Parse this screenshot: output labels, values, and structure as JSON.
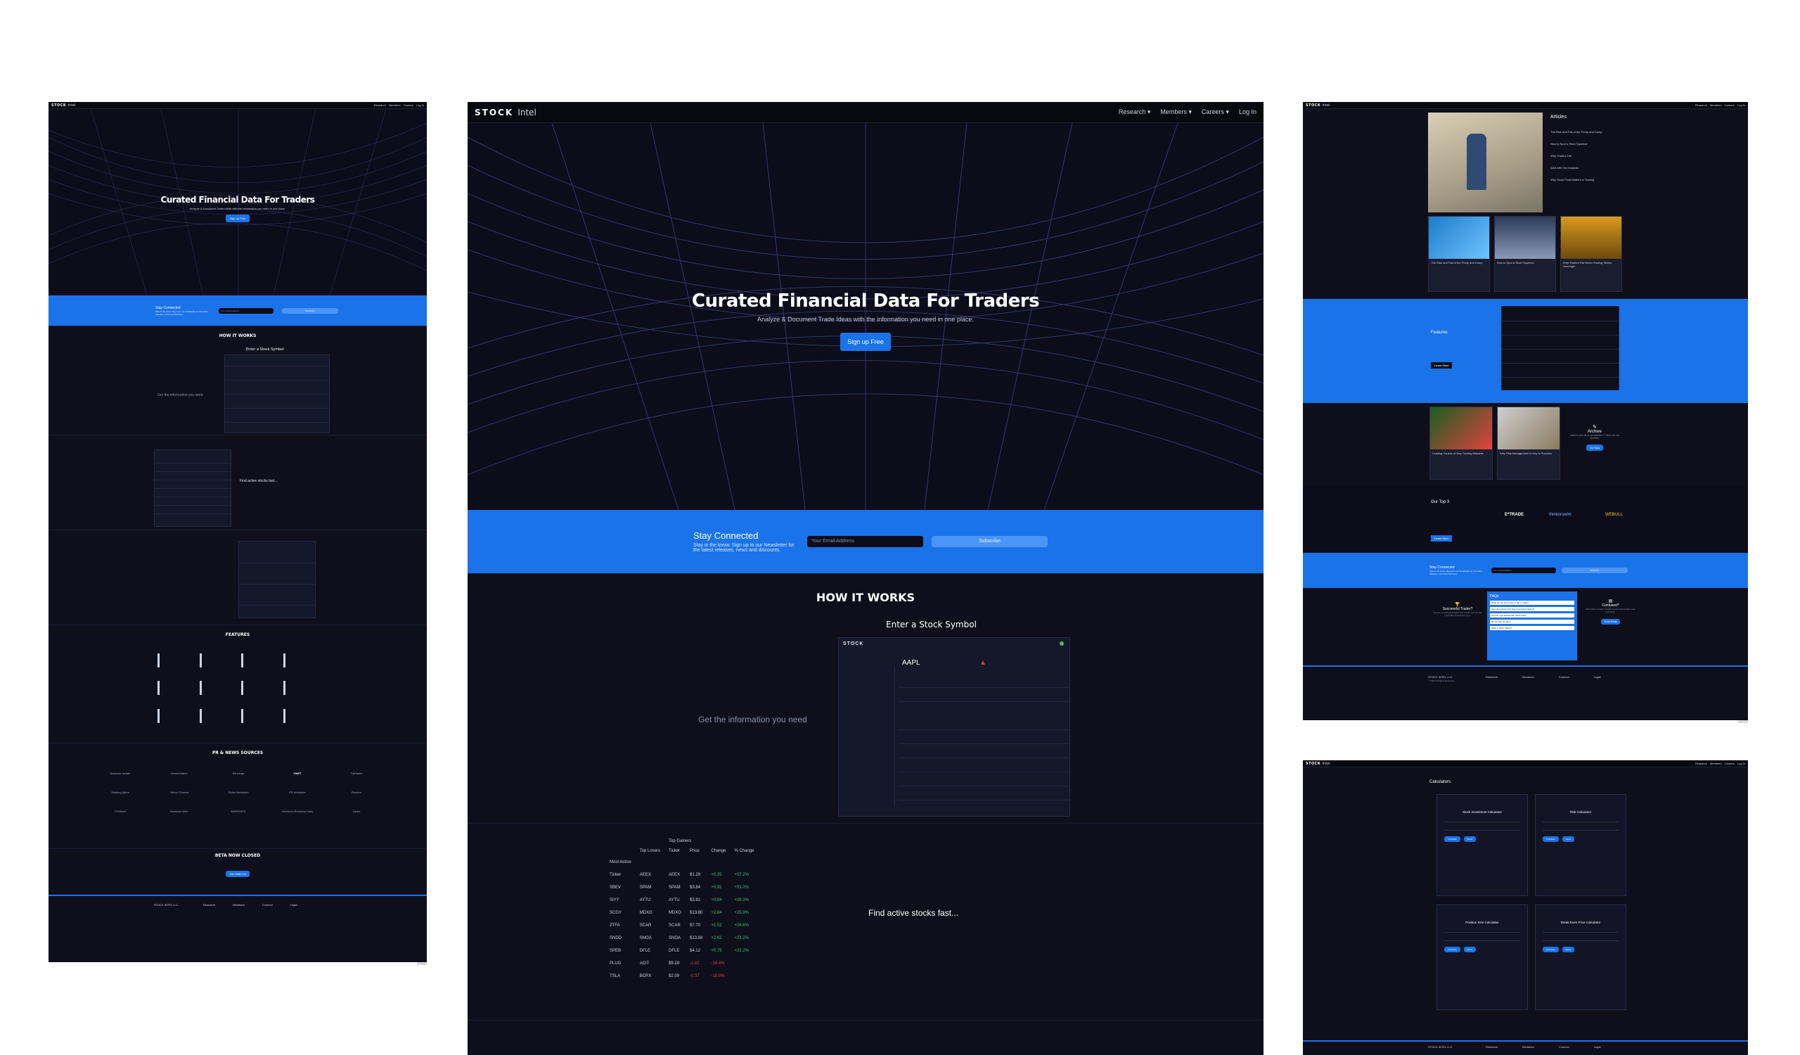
{
  "brand": {
    "logo_bold": "STOCK",
    "logo_light": "Intel"
  },
  "nav": {
    "research": "Research",
    "members": "Members",
    "careers": "Careers",
    "login": "Log In"
  },
  "hero": {
    "title": "Curated Financial Data For Traders",
    "subtitle": "Analyze & Document Trade Ideas with the information you need in one place.",
    "cta": "Sign up Free"
  },
  "stay": {
    "title": "Stay Connected",
    "text": "Stay in the know. Sign up to our Newsletter for the latest releases, news and discounts.",
    "email_placeholder": "Your Email Address",
    "subscribe": "Subscribe"
  },
  "how": {
    "title": "HOW IT WORKS",
    "step1": "Enter a Stock Symbol",
    "step2": "Get the information you need",
    "step3": "Find active stocks fast..."
  },
  "mock_ticker": {
    "symbol": "AAPL"
  },
  "gainers": {
    "title": "Top Gainers",
    "losers_title": "Top Losers",
    "most_active": "Most Active",
    "headers": [
      "Ticker",
      "Price",
      "Change",
      "% Change"
    ],
    "rows": [
      [
        "Ticker",
        "AEEX",
        "$1.29",
        "+0.35",
        "+37.2%"
      ],
      [
        "SBEV",
        "SPAM",
        "$3.84",
        "+0.91",
        "+31.0%"
      ],
      [
        "SIYY",
        "AYTU",
        "$3.81",
        "+0.84",
        "+28.3%"
      ],
      [
        "SCGY",
        "MDXG",
        "$13.80",
        "+2.84",
        "+25.9%"
      ],
      [
        "ZTFA",
        "SCAR",
        "$7.70",
        "+1.52",
        "+24.6%"
      ],
      [
        "SNDD",
        "SNOA",
        "$13.84",
        "+2.61",
        "+23.2%"
      ],
      [
        "SPEB",
        "DFLE",
        "$4.12",
        "+0.75",
        "+22.2%"
      ],
      [
        "PLUG",
        "ACIT",
        "$9.28",
        "-1.82",
        "-16.4%"
      ],
      [
        "TSLA",
        "BCRX",
        "$2.09",
        "-0.37",
        "-15.0%"
      ]
    ]
  },
  "mini_titles": {
    "hero_title": "Curated Financial Data For Traders",
    "how": "HOW IT WORKS",
    "features": "FEATURES",
    "pr_news": "PR & NEWS SOURCES",
    "beta": "BETA NOW CLOSED",
    "beta_btn": "Join Wait List",
    "step1": "Enter a Stock Symbol",
    "step2": "Get the information you need",
    "step3": "Find active stocks fast..."
  },
  "news_sources": [
    "Business Insider",
    "MarketWatch",
    "Benzinga",
    "CNET",
    "TipRanks",
    "Seeking Alpha",
    "Yahoo Finance",
    "Globe Newswire",
    "PR Newswire",
    "Reuters",
    "FXStreet",
    "Business Wire",
    "BARRON'S",
    "Investor's Business Daily",
    "Zacks"
  ],
  "articles": {
    "title": "Articles",
    "list": [
      "The Rise and Fall of the Pump and Dump",
      "How to Spot a Short Squeeze",
      "Why Traders Fail",
      "Q&A with Our Analysts",
      "Why Stock Float Matters in Trading"
    ],
    "cards": [
      "The Rise and Fall of the Pump and Dump",
      "How to Spot a Short Squeeze",
      "Why Traders Fail When Trading Stocks Overnight"
    ]
  },
  "features_band": {
    "title": "Features",
    "btn": "Learn More"
  },
  "archive": {
    "title": "Archive",
    "text": "Want to see all of our articles? Check out our Archive.",
    "btn": "Go Now",
    "cards": [
      "Leading Causes of Day Trading Mistakes",
      "Why Risk Management is Key to Success"
    ]
  },
  "partners": {
    "title": "Our Top 3",
    "btn": "Learn More",
    "logos": [
      "E*TRADE",
      "thinkorswim",
      "WEBULL"
    ]
  },
  "faqs": {
    "title": "FAQs",
    "items": [
      "What are the best times of day to trade?",
      "How does Stock Intel help successful trading?",
      "How do I get started with Stock Intel?",
      "Do we have an app?",
      "What is Short Selling?"
    ],
    "left_title": "Successful Trader?",
    "left_text": "Are you a successful trader with a track record? We would like to hear from you.",
    "right_title": "Confused?",
    "right_text": "We're here to help. Contact us and we'll answer your questions.",
    "right_btn": "Send Email"
  },
  "footer": {
    "company": "STOCK INTEL LLC",
    "rights": "© 2023 All Rights Reserved",
    "cols": [
      "Research",
      "Members",
      "Connect",
      "Legal"
    ]
  },
  "calculators": {
    "title": "Calculators",
    "cards": [
      "Stock Investment Calculator",
      "Risk Calculator",
      "Position Size Calculator",
      "Break Even Price Calculator"
    ],
    "btn1": "Calculate",
    "btn2": "Reset"
  },
  "colors": {
    "accent": "#1a73e8",
    "bg": "#0f0f1c",
    "up": "#39c26d",
    "down": "#e0433f"
  }
}
